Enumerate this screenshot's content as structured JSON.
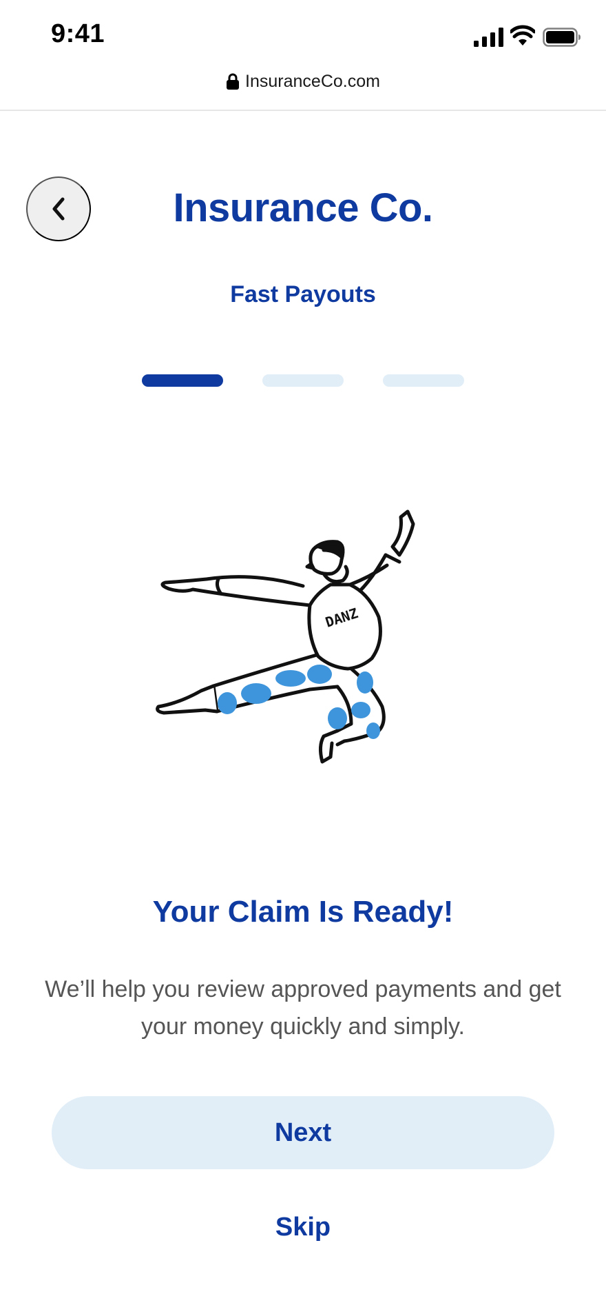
{
  "status_bar": {
    "time": "9:41",
    "icons": [
      "signal-icon",
      "wifi-icon",
      "battery-icon"
    ]
  },
  "address_bar": {
    "url": "InsuranceCo.com",
    "icon": "lock-icon"
  },
  "header": {
    "back_icon": "chevron-left-icon",
    "title": "Insurance Co.",
    "subtitle": "Fast Payouts"
  },
  "progress": {
    "total_steps": 3,
    "current_step": 1
  },
  "content": {
    "illustration": "dancing-man-illustration",
    "illustration_text": "DANZ",
    "heading": "Your Claim Is Ready!",
    "body": "We’ll help you review approved payments and get your money quickly and simply."
  },
  "actions": {
    "next_label": "Next",
    "skip_label": "Skip"
  },
  "colors": {
    "brand": "#0F3AA0",
    "button_bg": "#E1EEF8",
    "accent_blue": "#3E95DB",
    "body_text": "#555555"
  }
}
